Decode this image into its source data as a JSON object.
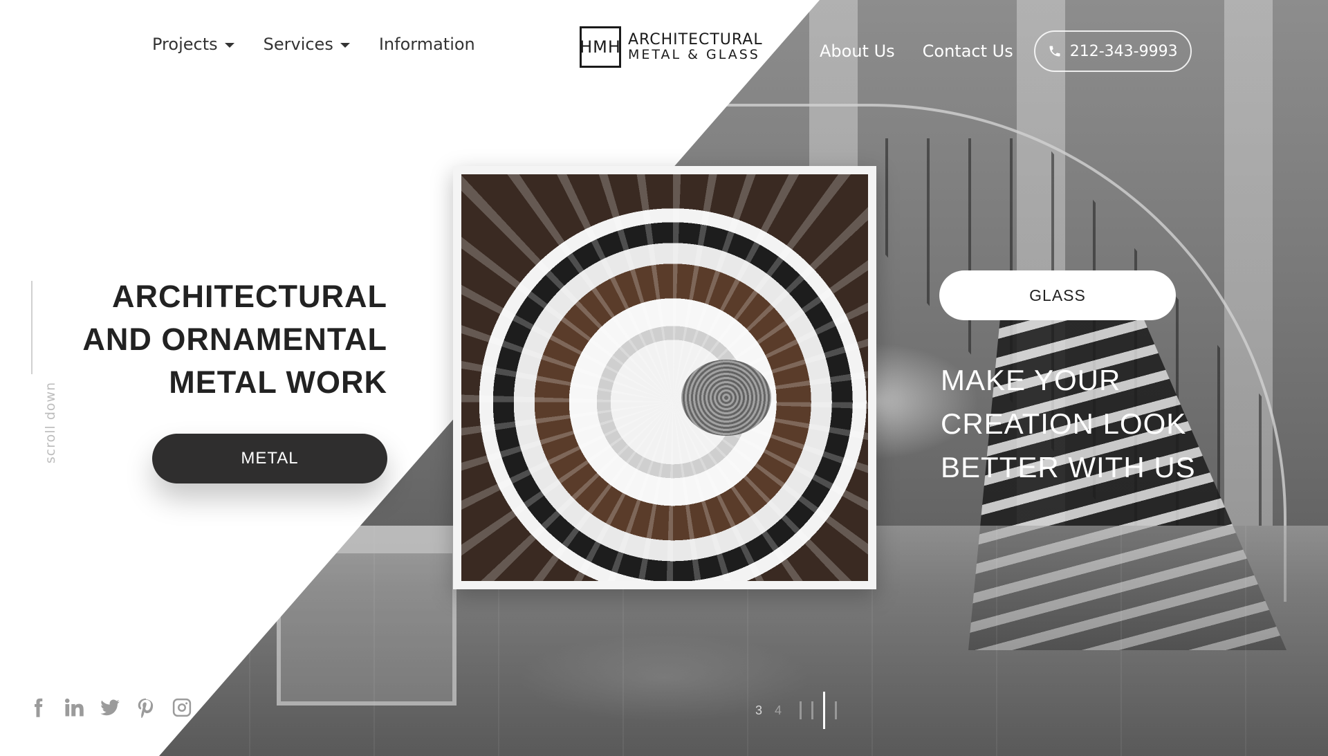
{
  "header": {
    "nav_left": [
      {
        "label": "Projects",
        "has_dropdown": true
      },
      {
        "label": "Services",
        "has_dropdown": true
      },
      {
        "label": "Information",
        "has_dropdown": false
      }
    ],
    "logo": {
      "mark": "HMH",
      "line1": "ARCHITECTURAL",
      "line2": "METAL & GLASS"
    },
    "nav_right": [
      {
        "label": "About Us"
      },
      {
        "label": "Contact Us"
      }
    ],
    "phone": {
      "icon": "phone-icon",
      "number": "212-343-9993"
    }
  },
  "hero": {
    "title_lines": [
      "ARCHITECTURAL",
      "AND ORNAMENTAL",
      "METAL WORK"
    ],
    "metal_button": "METAL",
    "glass_button": "GLASS",
    "tagline_lines": [
      "MAKE YOUR",
      "CREATION LOOK",
      "BETTER WITH US"
    ]
  },
  "sidebar": {
    "scroll_label": "scroll down"
  },
  "social": [
    {
      "icon": "facebook-icon"
    },
    {
      "icon": "linkedin-icon"
    },
    {
      "icon": "twitter-icon"
    },
    {
      "icon": "pinterest-icon"
    },
    {
      "icon": "instagram-icon"
    }
  ],
  "slider": {
    "current": "3",
    "next": "4",
    "active_index": 2,
    "total_bars": 4
  },
  "colors": {
    "dark_button": "#2f2e2e",
    "white": "#ffffff",
    "text_dark": "#222222",
    "muted": "#9b9b9b"
  }
}
